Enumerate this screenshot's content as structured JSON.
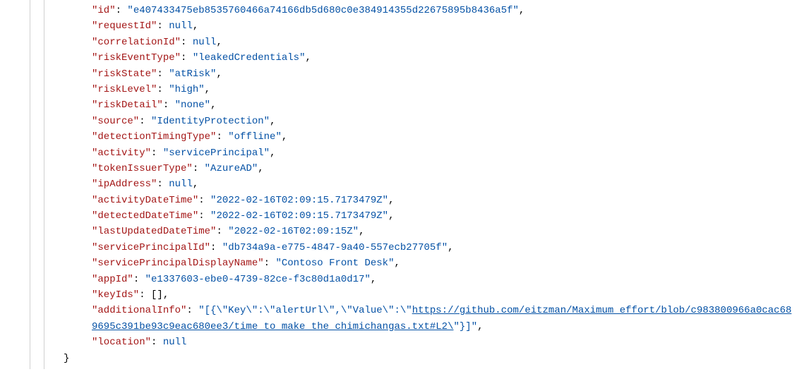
{
  "json": {
    "id_key": "\"id\"",
    "id_val": "\"e407433475eb8535760466a74166db5d680c0e384914355d22675895b8436a5f\"",
    "requestId_key": "\"requestId\"",
    "requestId_val": "null",
    "correlationId_key": "\"correlationId\"",
    "correlationId_val": "null",
    "riskEventType_key": "\"riskEventType\"",
    "riskEventType_val": "\"leakedCredentials\"",
    "riskState_key": "\"riskState\"",
    "riskState_val": "\"atRisk\"",
    "riskLevel_key": "\"riskLevel\"",
    "riskLevel_val": "\"high\"",
    "riskDetail_key": "\"riskDetail\"",
    "riskDetail_val": "\"none\"",
    "source_key": "\"source\"",
    "source_val": "\"IdentityProtection\"",
    "detectionTimingType_key": "\"detectionTimingType\"",
    "detectionTimingType_val": "\"offline\"",
    "activity_key": "\"activity\"",
    "activity_val": "\"servicePrincipal\"",
    "tokenIssuerType_key": "\"tokenIssuerType\"",
    "tokenIssuerType_val": "\"AzureAD\"",
    "ipAddress_key": "\"ipAddress\"",
    "ipAddress_val": "null",
    "activityDateTime_key": "\"activityDateTime\"",
    "activityDateTime_val": "\"2022-02-16T02:09:15.7173479Z\"",
    "detectedDateTime_key": "\"detectedDateTime\"",
    "detectedDateTime_val": "\"2022-02-16T02:09:15.7173479Z\"",
    "lastUpdatedDateTime_key": "\"lastUpdatedDateTime\"",
    "lastUpdatedDateTime_val": "\"2022-02-16T02:09:15Z\"",
    "servicePrincipalId_key": "\"servicePrincipalId\"",
    "servicePrincipalId_val": "\"db734a9a-e775-4847-9a40-557ecb27705f\"",
    "servicePrincipalDisplayName_key": "\"servicePrincipalDisplayName\"",
    "servicePrincipalDisplayName_val": "\"Contoso Front Desk\"",
    "appId_key": "\"appId\"",
    "appId_val": "\"e1337603-ebe0-4739-82ce-f3c80d1a0d17\"",
    "keyIds_key": "\"keyIds\"",
    "keyIds_val": "[]",
    "additionalInfo_key": "\"additionalInfo\"",
    "additionalInfo_pre": "\"[{\\\"Key\\\":\\\"alertUrl\\\",\\\"Value\\\":\\\"",
    "additionalInfo_link": "https://github.com/eitzman/Maximum_effort/blob/c983800966a0cac689695c391be93c9eac680ee3/time_to_make_the_chimichangas.txt#L2\\",
    "additionalInfo_post": "\"}]\"",
    "location_key": "\"location\"",
    "location_val": "null",
    "close_brace": "}"
  }
}
